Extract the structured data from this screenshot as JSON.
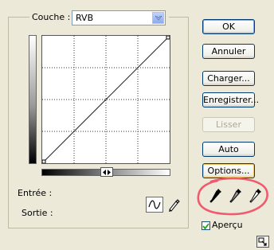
{
  "channel": {
    "label": "Couche :",
    "value": "RVB"
  },
  "buttons": {
    "ok": "OK",
    "cancel": "Annuler",
    "load": "Charger...",
    "save": "Enregistrer...",
    "smooth": "Lisser",
    "auto": "Auto",
    "options": "Options..."
  },
  "labels": {
    "input": "Entrée :",
    "output": "Sortie :"
  },
  "preview": {
    "label": "Aperçu",
    "checked": true
  },
  "icons": {
    "channel_dropdown": "chevron-down-icon",
    "gradient_toggle": "double-arrow-icon",
    "curve_tool": "curve-icon",
    "pencil_tool": "pencil-icon",
    "eyedroppers": [
      "black-eyedropper-icon",
      "gray-eyedropper-icon",
      "white-eyedropper-icon"
    ],
    "expand": "expand-icon"
  },
  "colors": {
    "dialog_bg": "#ece9d8",
    "button_border": "#003c74",
    "highlight_circle": "#f05a6e"
  }
}
